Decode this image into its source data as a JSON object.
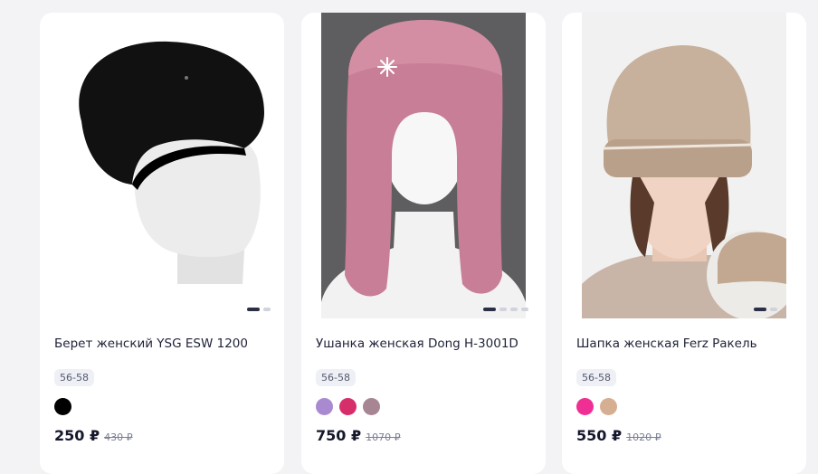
{
  "products": [
    {
      "title": "Берет женский YSG ESW 1200",
      "size": "56-58",
      "price": "250 ₽",
      "old_price": "430 ₽",
      "swatches": [
        "#000000"
      ],
      "image_icon": "beret-on-mannequin-image"
    },
    {
      "title": "Ушанка женская Dong H-3001D",
      "size": "56-58",
      "price": "750 ₽",
      "old_price": "1070 ₽",
      "swatches": [
        "#a98ad1",
        "#d62e6a",
        "#a88593"
      ],
      "image_icon": "ushanka-on-mannequin-image"
    },
    {
      "title": "Шапка женская Ferz Ракель",
      "size": "56-58",
      "price": "550 ₽",
      "old_price": "1020 ₽",
      "swatches": [
        "#ef2f94",
        "#d6ae92"
      ],
      "image_icon": "knit-hat-on-model-image"
    }
  ]
}
